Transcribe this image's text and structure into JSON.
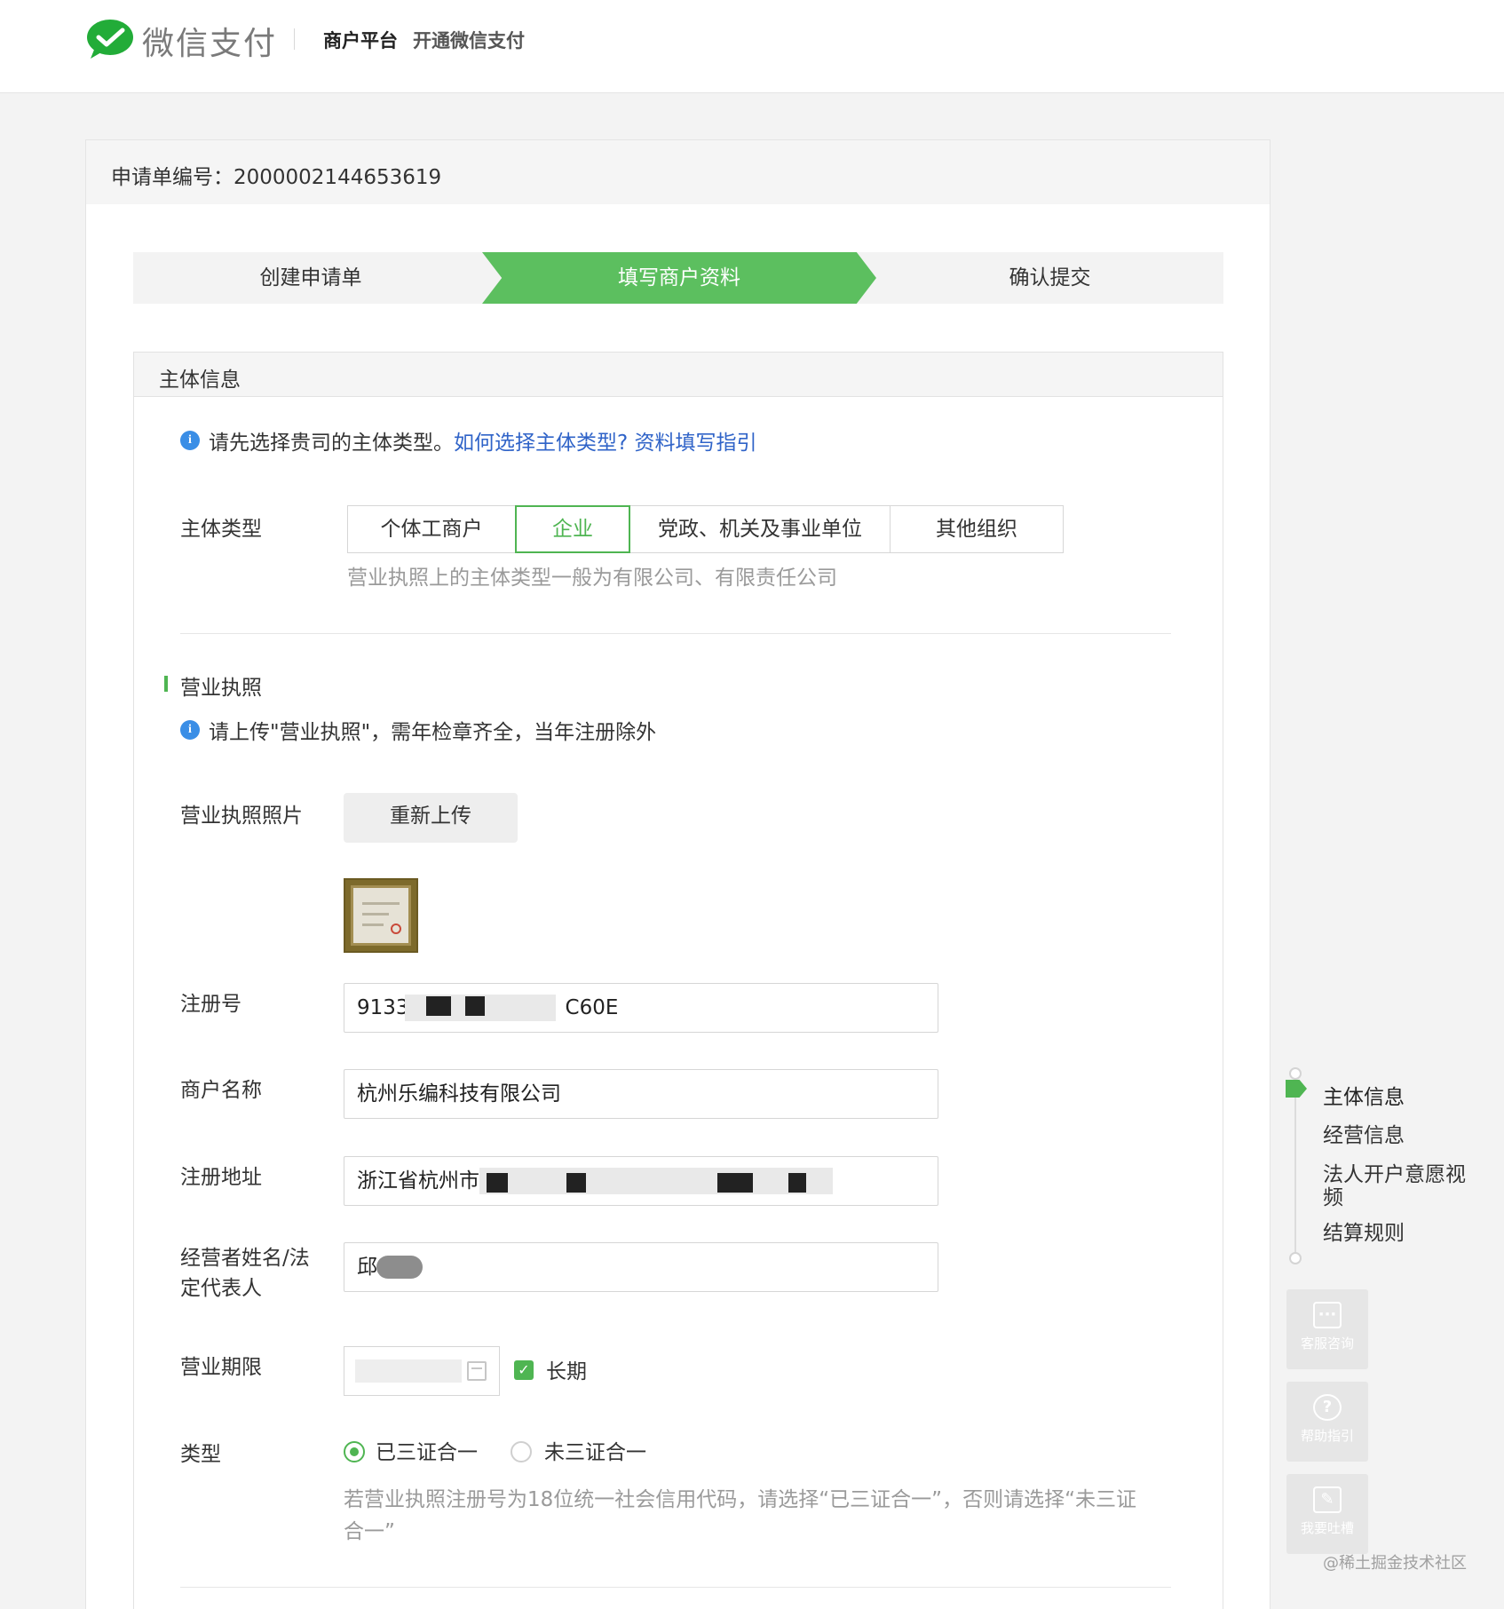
{
  "header": {
    "logo_text": "微信支付",
    "nav_platform": "商户平台",
    "nav_open": "开通微信支付"
  },
  "application": {
    "label": "申请单编号：",
    "number": "2000002144653619"
  },
  "steps": [
    "创建申请单",
    "填写商户资料",
    "确认提交"
  ],
  "section": {
    "title": "主体信息",
    "tip_text": "请先选择贵司的主体类型。",
    "tip_link_1": "如何选择主体类型?",
    "tip_link_2": "资料填写指引",
    "subject_type_label": "主体类型",
    "subject_types": [
      "个体工商户",
      "企业",
      "党政、机关及事业单位",
      "其他组织"
    ],
    "subject_type_selected": "企业",
    "subject_hint": "营业执照上的主体类型一般为有限公司、有限责任公司"
  },
  "license": {
    "title": "营业执照",
    "tip": "请上传\"营业执照\"，需年检章齐全，当年注册除外",
    "photo_label": "营业执照照片",
    "reupload": "重新上传",
    "reg_no_label": "注册号",
    "reg_no_prefix": "9133",
    "reg_no_suffix": "C60E",
    "merchant_name_label": "商户名称",
    "merchant_name": "杭州乐编科技有限公司",
    "address_label": "注册地址",
    "address_prefix": "浙江省杭州市",
    "legal_label_1": "经营者姓名/法",
    "legal_label_2": "定代表人",
    "legal_name_prefix": "邱",
    "term_label": "营业期限",
    "long_term": "长期",
    "long_term_checked": true,
    "type_label": "类型",
    "type_options": [
      "已三证合一",
      "未三证合一"
    ],
    "type_selected": "已三证合一",
    "type_hint_1": "若营业执照注册号为18位统一社会信用代码，请选择“已三证合一”，否则请选择“未三证",
    "type_hint_2": "合一”"
  },
  "side_nav": {
    "items": [
      "主体信息",
      "经营信息",
      "法人开户意愿视频",
      "结算规则"
    ],
    "active": "主体信息"
  },
  "float_buttons": [
    "客服咨询",
    "帮助指引",
    "我要吐槽"
  ],
  "watermark": "@稀土掘金技术社区",
  "colors": {
    "brand_green": "#4fb552",
    "step_active": "#5cbf5f",
    "link_blue": "#2f63c8",
    "info_blue": "#3a8ee6"
  }
}
